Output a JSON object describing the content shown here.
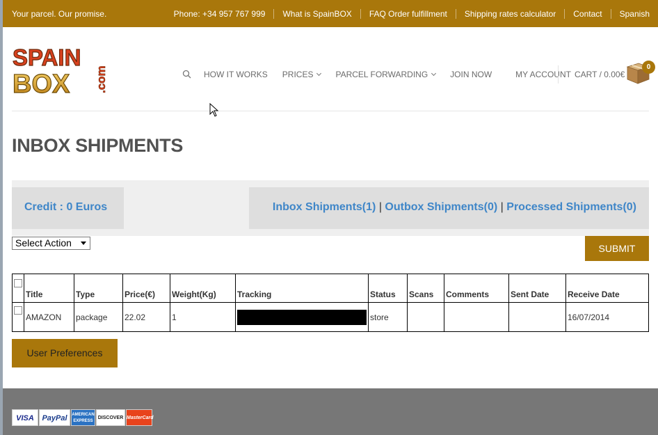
{
  "topbar": {
    "slogan": "Your parcel. Our promise.",
    "links": [
      "Phone: +34 957 767 999",
      "What is SpainBOX",
      "FAQ Order fulfillment",
      "Shipping rates calculator",
      "Contact",
      "Spanish"
    ]
  },
  "logo": {
    "line1": "SPAIN",
    "line2": "BOX",
    "suffix": ".com"
  },
  "nav": {
    "how_it_works": "HOW IT WORKS",
    "prices": "PRICES",
    "parcel_forwarding": "PARCEL FORWARDING",
    "join_now": "JOIN NOW",
    "my_account": "MY ACCOUNT",
    "cart": "CART / 0.00€",
    "cart_count": "0"
  },
  "page": {
    "title": "INBOX SHIPMENTS"
  },
  "credit": "Credit : 0 Euros",
  "shipments": {
    "inbox": "Inbox Shipments(1)",
    "outbox": "Outbox Shipments(0)",
    "processed": "Processed Shipments(0)",
    "separator": "|"
  },
  "action_select": {
    "value": "Select Action"
  },
  "submit_label": "SUBMIT",
  "table": {
    "headers": [
      "Title",
      "Type",
      "Price(€)",
      "Weight(Kg)",
      "Tracking",
      "Status",
      "Scans",
      "Comments",
      "Sent Date",
      "Receive Date"
    ],
    "rows": [
      {
        "title": "AMAZON",
        "type": "package",
        "price": "22.02",
        "weight": "1",
        "tracking": "",
        "status": "store",
        "scans": "",
        "comments": "",
        "sent_date": "",
        "receive_date": "16/07/2014"
      }
    ]
  },
  "user_preferences_label": "User Preferences",
  "payment_cards": [
    "VISA",
    "PayPal",
    "AMERICAN EXPRESS",
    "DISCOVER",
    "MasterCard"
  ],
  "colors": {
    "brand": "#a9770b",
    "link": "#3f86c8",
    "footer": "#777777"
  }
}
